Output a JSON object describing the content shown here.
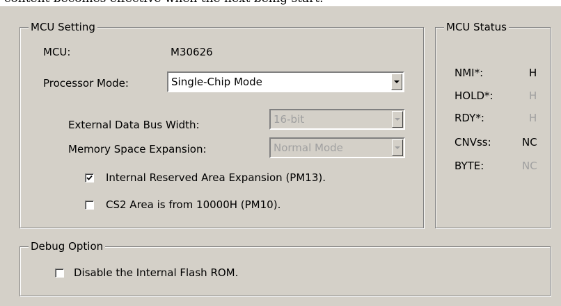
{
  "top_text": "content becomes effective when the next being start.",
  "mcu_setting": {
    "legend": "MCU Setting",
    "mcu_label": "MCU:",
    "mcu_value": "M30626",
    "processor_mode_label": "Processor Mode:",
    "processor_mode_value": "Single-Chip Mode",
    "ext_bus_label": "External Data Bus Width:",
    "ext_bus_value": "16-bit",
    "mem_exp_label": "Memory Space Expansion:",
    "mem_exp_value": "Normal Mode",
    "pm13_label": "Internal Reserved Area Expansion (PM13).",
    "pm13_checked": true,
    "pm10_label": "CS2 Area is from 10000H (PM10).",
    "pm10_checked": false
  },
  "mcu_status": {
    "legend": "MCU Status",
    "rows": [
      {
        "label": "NMI*:",
        "value": "H"
      },
      {
        "label": "HOLD*:",
        "value": "H"
      },
      {
        "label": "RDY*:",
        "value": "H"
      },
      {
        "label": "CNVss:",
        "value": "NC"
      },
      {
        "label": "BYTE:",
        "value": "NC"
      }
    ]
  },
  "debug_option": {
    "legend": "Debug Option",
    "disable_flash_label": "Disable the Internal Flash ROM.",
    "disable_flash_checked": false
  }
}
